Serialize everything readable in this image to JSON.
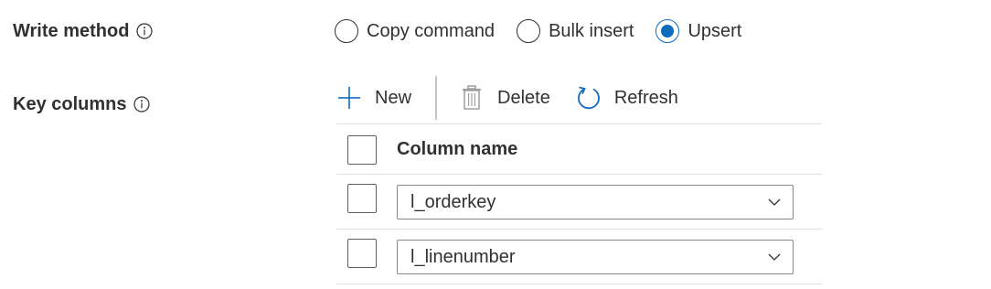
{
  "write_method": {
    "label": "Write method",
    "options": [
      {
        "label": "Copy command",
        "checked": false
      },
      {
        "label": "Bulk insert",
        "checked": false
      },
      {
        "label": "Upsert",
        "checked": true
      }
    ]
  },
  "key_columns": {
    "label": "Key columns",
    "toolbar": {
      "new_label": "New",
      "delete_label": "Delete",
      "refresh_label": "Refresh"
    },
    "grid": {
      "header": "Column name",
      "rows": [
        {
          "value": "l_orderkey"
        },
        {
          "value": "l_linenumber"
        }
      ]
    }
  },
  "icons": {
    "info": "info-icon",
    "add": "plus-icon",
    "delete": "trash-icon",
    "refresh": "refresh-icon",
    "dropdown": "chevron-down-icon"
  },
  "colors": {
    "accent": "#0f6cbd",
    "text": "#323130",
    "border": "#8a8886"
  }
}
